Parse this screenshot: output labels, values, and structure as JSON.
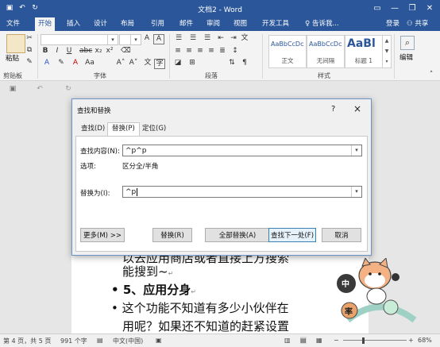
{
  "window": {
    "title": "文档2 - Word"
  },
  "tabs": [
    "文件",
    "开始",
    "插入",
    "设计",
    "布局",
    "引用",
    "邮件",
    "审阅",
    "视图",
    "开发工具"
  ],
  "active_tab": "开始",
  "tell_me": "告诉我...",
  "account": {
    "login": "登录",
    "share": "共享"
  },
  "ribbon": {
    "paste_label": "粘贴",
    "clipboard_label": "剪贴板",
    "font_label": "字体",
    "paragraph_label": "段落",
    "styles_label": "样式",
    "edit_label": "编辑",
    "styles": [
      {
        "sample": "AaBbCcDc",
        "name": "正文"
      },
      {
        "sample": "AaBbCcDc",
        "name": "无间隔"
      },
      {
        "sample": "AaBl",
        "name": "标题 1"
      }
    ]
  },
  "document": {
    "lines": [
      "以去应用商店或者直接上方搜索",
      "能搜到~",
      "5、应用分身",
      "这个功能不知道有多少小伙伴在",
      "用呢？如果还不知道的赶紧设置"
    ]
  },
  "dialog": {
    "title": "查找和替换",
    "help": "?",
    "close": "×",
    "tabs": [
      "查找(D)",
      "替换(P)",
      "定位(G)"
    ],
    "active_tab": "替换(P)",
    "find_label": "查找内容(N):",
    "find_value": "^p^p",
    "options_label": "选项:",
    "options_value": "区分全/半角",
    "replace_label": "替换为(I):",
    "replace_value": "^p",
    "buttons": {
      "more": "更多(M) >>",
      "replace": "替换(R)",
      "replace_all": "全部替换(A)",
      "find_next": "查找下一处(F)",
      "cancel": "取消"
    }
  },
  "status": {
    "page": "第 4 页，共 5 页",
    "words": "991 个字",
    "language": "中文(中国)",
    "zoom": "68%"
  },
  "sticker": {
    "labels": [
      "中",
      "率"
    ]
  }
}
